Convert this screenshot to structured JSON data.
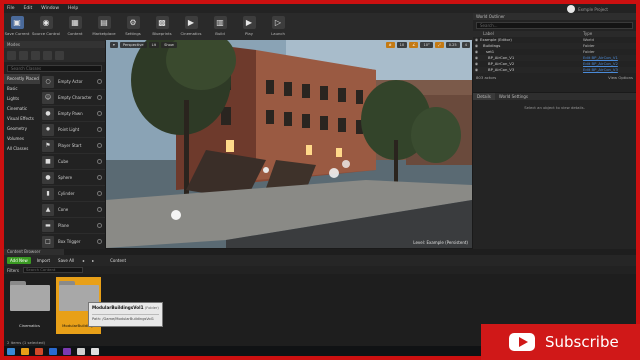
{
  "menubar": {
    "items": [
      "File",
      "Edit",
      "Window",
      "Help"
    ],
    "project": "Exmple Project"
  },
  "toolbar": [
    {
      "label": "Save Current",
      "icon": "save-icon",
      "color": "#4a6a9a",
      "glyph": "▣"
    },
    {
      "label": "Source Control",
      "icon": "source-control-icon",
      "color": "#3d3d3d",
      "glyph": "◉"
    },
    {
      "label": "Content",
      "icon": "content-icon",
      "color": "#3d3d3d",
      "glyph": "▦"
    },
    {
      "label": "Marketplace",
      "icon": "marketplace-icon",
      "color": "#3d3d3d",
      "glyph": "▤"
    },
    {
      "label": "Settings",
      "icon": "settings-icon",
      "color": "#3d3d3d",
      "glyph": "⚙"
    },
    {
      "label": "Blueprints",
      "icon": "blueprints-icon",
      "color": "#3d3d3d",
      "glyph": "▩"
    },
    {
      "label": "Cinematics",
      "icon": "cinematics-icon",
      "color": "#3d3d3d",
      "glyph": "▶"
    },
    {
      "label": "Build",
      "icon": "build-icon",
      "color": "#3d3d3d",
      "glyph": "▥"
    },
    {
      "label": "Play",
      "icon": "play-icon",
      "color": "#3d3d3d",
      "glyph": "▶"
    },
    {
      "label": "Launch",
      "icon": "launch-icon",
      "color": "#3d3d3d",
      "glyph": "▷"
    }
  ],
  "modes": {
    "tab": "Modes",
    "search_placeholder": "Search Classes",
    "categories": [
      "Recently Placed",
      "Basic",
      "Lights",
      "Cinematic",
      "Visual Effects",
      "Geometry",
      "Volumes",
      "All Classes"
    ],
    "items": [
      {
        "name": "Empty Actor",
        "glyph": "○"
      },
      {
        "name": "Empty Character",
        "glyph": "☺"
      },
      {
        "name": "Empty Pawn",
        "glyph": "●"
      },
      {
        "name": "Point Light",
        "glyph": "✹"
      },
      {
        "name": "Player Start",
        "glyph": "⚑"
      },
      {
        "name": "Cube",
        "glyph": "■"
      },
      {
        "name": "Sphere",
        "glyph": "●"
      },
      {
        "name": "Cylinder",
        "glyph": "▮"
      },
      {
        "name": "Cone",
        "glyph": "▲"
      },
      {
        "name": "Plane",
        "glyph": "▬"
      },
      {
        "name": "Box Trigger",
        "glyph": "□"
      }
    ]
  },
  "viewport": {
    "buttons": [
      "Perspective",
      "Lit",
      "Show"
    ],
    "snap_values": [
      "10",
      "10°",
      "0.25",
      "4"
    ],
    "level": "Level:  Example (Persistent)"
  },
  "outliner": {
    "tab": "World Outliner",
    "search_placeholder": "Search...",
    "col_label": "Label",
    "col_type": "Type",
    "rows": [
      {
        "name": "Example (Editor)",
        "type": "World",
        "link": false
      },
      {
        "name": "Buildings",
        "type": "Folder",
        "link": false
      },
      {
        "name": "set1",
        "type": "Folder",
        "link": false
      },
      {
        "name": "BP_AirCon_V1",
        "type": "Edit BP_AirCon_V1",
        "link": true
      },
      {
        "name": "BP_AirCon_V2",
        "type": "Edit BP_AirCon_V2",
        "link": true
      },
      {
        "name": "BP_AirCon_V3",
        "type": "Edit BP_AirCon_V3",
        "link": true
      }
    ],
    "count": "803 actors",
    "view_options": "View Options"
  },
  "details": {
    "tabs": [
      "Details",
      "World Settings"
    ],
    "message": "Select an object to view details."
  },
  "content_browser": {
    "tab": "Content Browser",
    "add_new": "Add New",
    "import": "Import",
    "save_all": "Save All",
    "path": "Content",
    "filters": "Filters",
    "search_placeholder": "Search Content",
    "folders": [
      "Cinematics",
      "ModularBuildings"
    ],
    "status": "2 items (1 selected)"
  },
  "tooltip": {
    "title": "ModularBuildingsVol1",
    "kind": "(Folder)",
    "path": "Path: /Game/ModularBuildingsVol1"
  },
  "overlay": {
    "subscribe": "Subscribe"
  },
  "taskbar": [
    "#3a8ad8",
    "#e8a018",
    "#d04a2a",
    "#2a6ad0",
    "#7a3ab0",
    "#d0d0d0",
    "#e0e0e0"
  ]
}
